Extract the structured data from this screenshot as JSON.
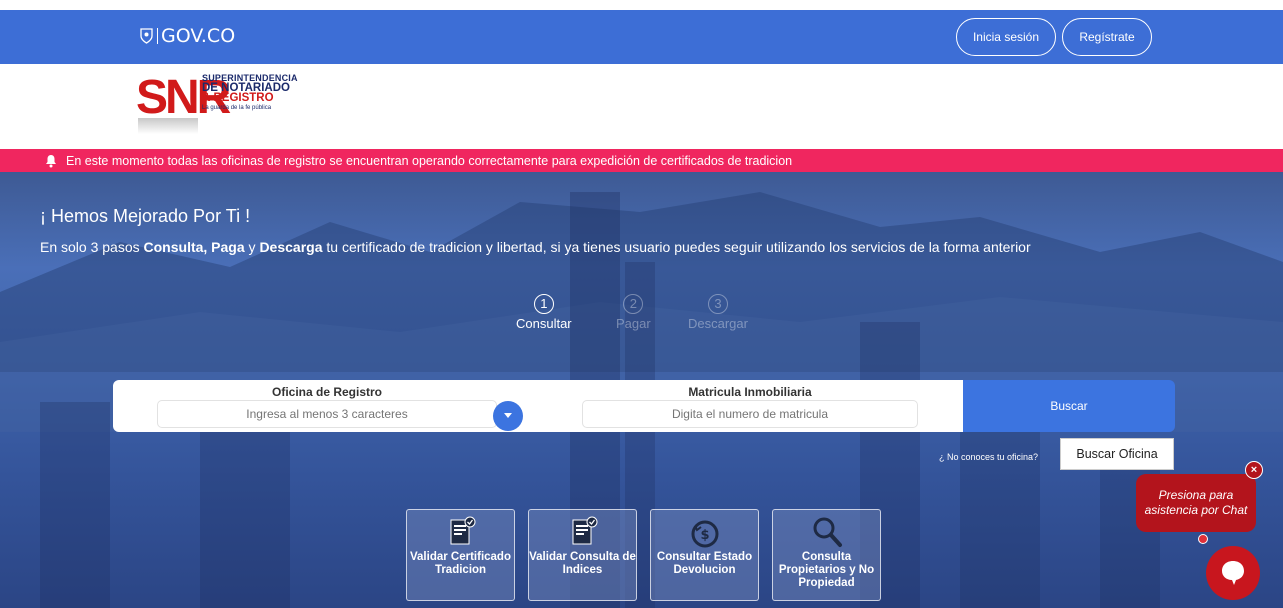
{
  "gov": {
    "logo_text": "GOV.CO",
    "login_label": "Inicia sesión",
    "register_label": "Regístrate"
  },
  "brand": {
    "letters": "SNR",
    "line1": "SUPERINTENDENCIA",
    "line2": "DE NOTARIADO",
    "line3": "& REGISTRO",
    "tagline": "La guarda de la fe pública"
  },
  "alert": {
    "message": "En este momento todas las oficinas de registro se encuentran operando correctamente para expedición de certificados de tradicion"
  },
  "hero": {
    "title": "¡ Hemos Mejorado Por Ti !",
    "lead_prefix": "En solo 3 pasos ",
    "lead_bold1": "Consulta, Paga",
    "lead_mid": " y ",
    "lead_bold2": "Descarga",
    "lead_suffix": " tu certificado de tradicion y libertad, si ya tienes usuario puedes seguir utilizando los servicios de la forma anterior"
  },
  "steps": [
    {
      "number": "1",
      "label": "Consultar"
    },
    {
      "number": "2",
      "label": "Pagar"
    },
    {
      "number": "3",
      "label": "Descargar"
    }
  ],
  "search": {
    "office_label": "Oficina de Registro",
    "office_placeholder": "Ingresa al menos 3 caracteres",
    "matricula_label": "Matricula Inmobiliaria",
    "matricula_placeholder": "Digita el numero de matricula",
    "submit_label": "Buscar",
    "help_text": "¿ No conoces tu oficina?",
    "find_office_label": "Buscar Oficina"
  },
  "tiles": [
    {
      "label": "Validar Certificado Tradicion",
      "icon": "document-check-icon"
    },
    {
      "label": "Validar Consulta de Indices",
      "icon": "document-check-icon"
    },
    {
      "label": "Consultar Estado Devolucion",
      "icon": "money-refund-icon"
    },
    {
      "label": "Consulta Propietarios y No Propiedad",
      "icon": "magnifier-icon"
    }
  ],
  "chat": {
    "prompt": "Presiona para asistencia por Chat",
    "close": "×"
  },
  "colors": {
    "gov_blue": "#3d6ed6",
    "alert_pink": "#f0265f",
    "primary_blue": "#3c74e0",
    "chat_red": "#b3141c",
    "brand_red": "#d11a1a"
  }
}
